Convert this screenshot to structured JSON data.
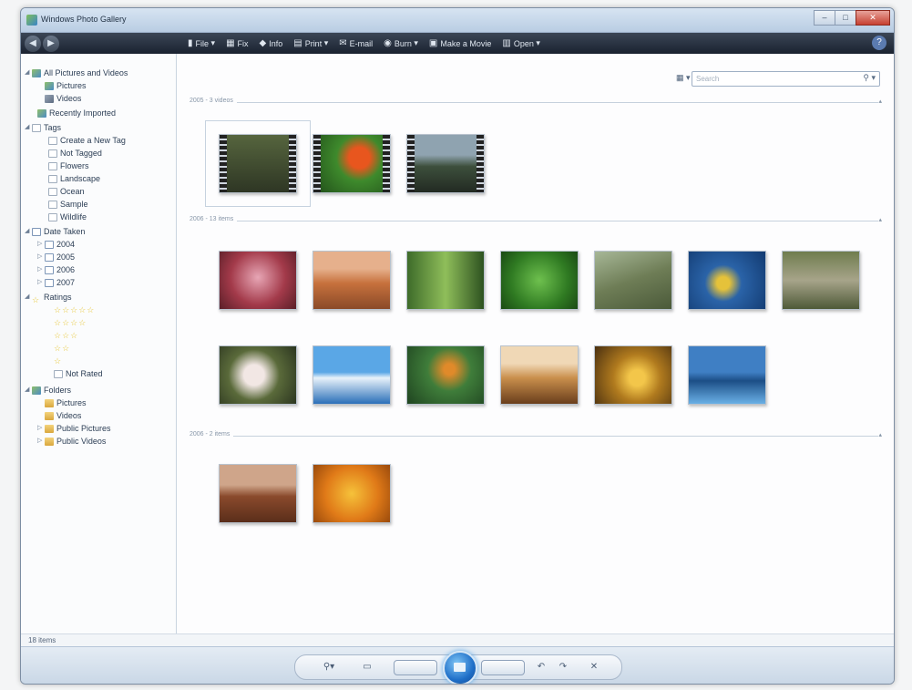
{
  "window": {
    "title": "Windows Photo Gallery"
  },
  "toolbar": {
    "items": [
      {
        "label": "File",
        "icon": "file-icon"
      },
      {
        "label": "Fix",
        "icon": "fix-icon"
      },
      {
        "label": "Info",
        "icon": "info-icon"
      },
      {
        "label": "Print",
        "icon": "print-icon"
      },
      {
        "label": "E-mail",
        "icon": "email-icon"
      },
      {
        "label": "Burn",
        "icon": "burn-icon"
      },
      {
        "label": "Make a Movie",
        "icon": "movie-icon"
      },
      {
        "label": "Open",
        "icon": "open-icon"
      }
    ]
  },
  "sidebar": {
    "all": "All Pictures and Videos",
    "pictures": "Pictures",
    "videos": "Videos",
    "recent": "Recently Imported",
    "tags": "Tags",
    "create_tag": "Create a New Tag",
    "not_tagged": "Not Tagged",
    "tag_flowers": "Flowers",
    "tag_landscape": "Landscape",
    "tag_ocean": "Ocean",
    "tag_sample": "Sample",
    "tag_wildlife": "Wildlife",
    "date_taken": "Date Taken",
    "y2004": "2004",
    "y2005": "2005",
    "y2006": "2006",
    "y2007": "2007",
    "ratings": "Ratings",
    "not_rated": "Not Rated",
    "folders": "Folders",
    "f_pictures": "Pictures",
    "f_videos": "Videos",
    "public_pictures": "Public Pictures",
    "public_videos": "Public Videos"
  },
  "content": {
    "search_placeholder": "Search",
    "groups": [
      {
        "label": "2005 - 3 videos"
      },
      {
        "label": "2006 - 13 items"
      },
      {
        "label": "2006 - 2 items"
      }
    ]
  },
  "status": {
    "items": "18 items"
  },
  "controls": {
    "prev": "",
    "next": ""
  },
  "colors": {
    "toolbar": "#1a2230",
    "play": "#1f6fc8",
    "stars": "#e8c941"
  }
}
